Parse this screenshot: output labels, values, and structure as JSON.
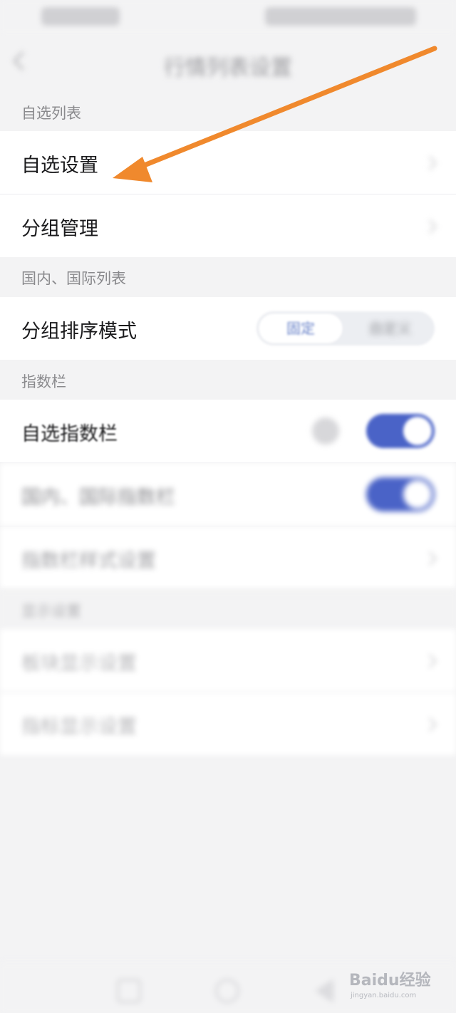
{
  "status_bar": {
    "time": "",
    "icons": ""
  },
  "nav": {
    "title": "行情列表设置",
    "back_icon": "chevron-left-icon"
  },
  "sections": {
    "watchlist": {
      "header": "自选列表",
      "items": [
        "自选设置",
        "分组管理"
      ]
    },
    "domestic_intl": {
      "header": "国内、国际列表",
      "sort_label": "分组排序模式",
      "sort_options": [
        "固定",
        "自定义"
      ],
      "sort_selected": "固定"
    },
    "index_bar": {
      "header": "指数栏",
      "items": [
        {
          "label": "自选指数栏",
          "on": true
        },
        {
          "label": "国内、国际指数栏",
          "on": true
        },
        {
          "label": "指数栏样式设置"
        }
      ]
    },
    "display": {
      "header": "显示设置",
      "items": [
        "板块显示设置",
        "指标显示设置"
      ]
    }
  },
  "watermark": {
    "brand": "Baidu经验",
    "url": "jingyan.baidu.com"
  },
  "colors": {
    "accent": "#4a63c7",
    "arrow": "#f0892d",
    "background": "#f3f3f4"
  }
}
